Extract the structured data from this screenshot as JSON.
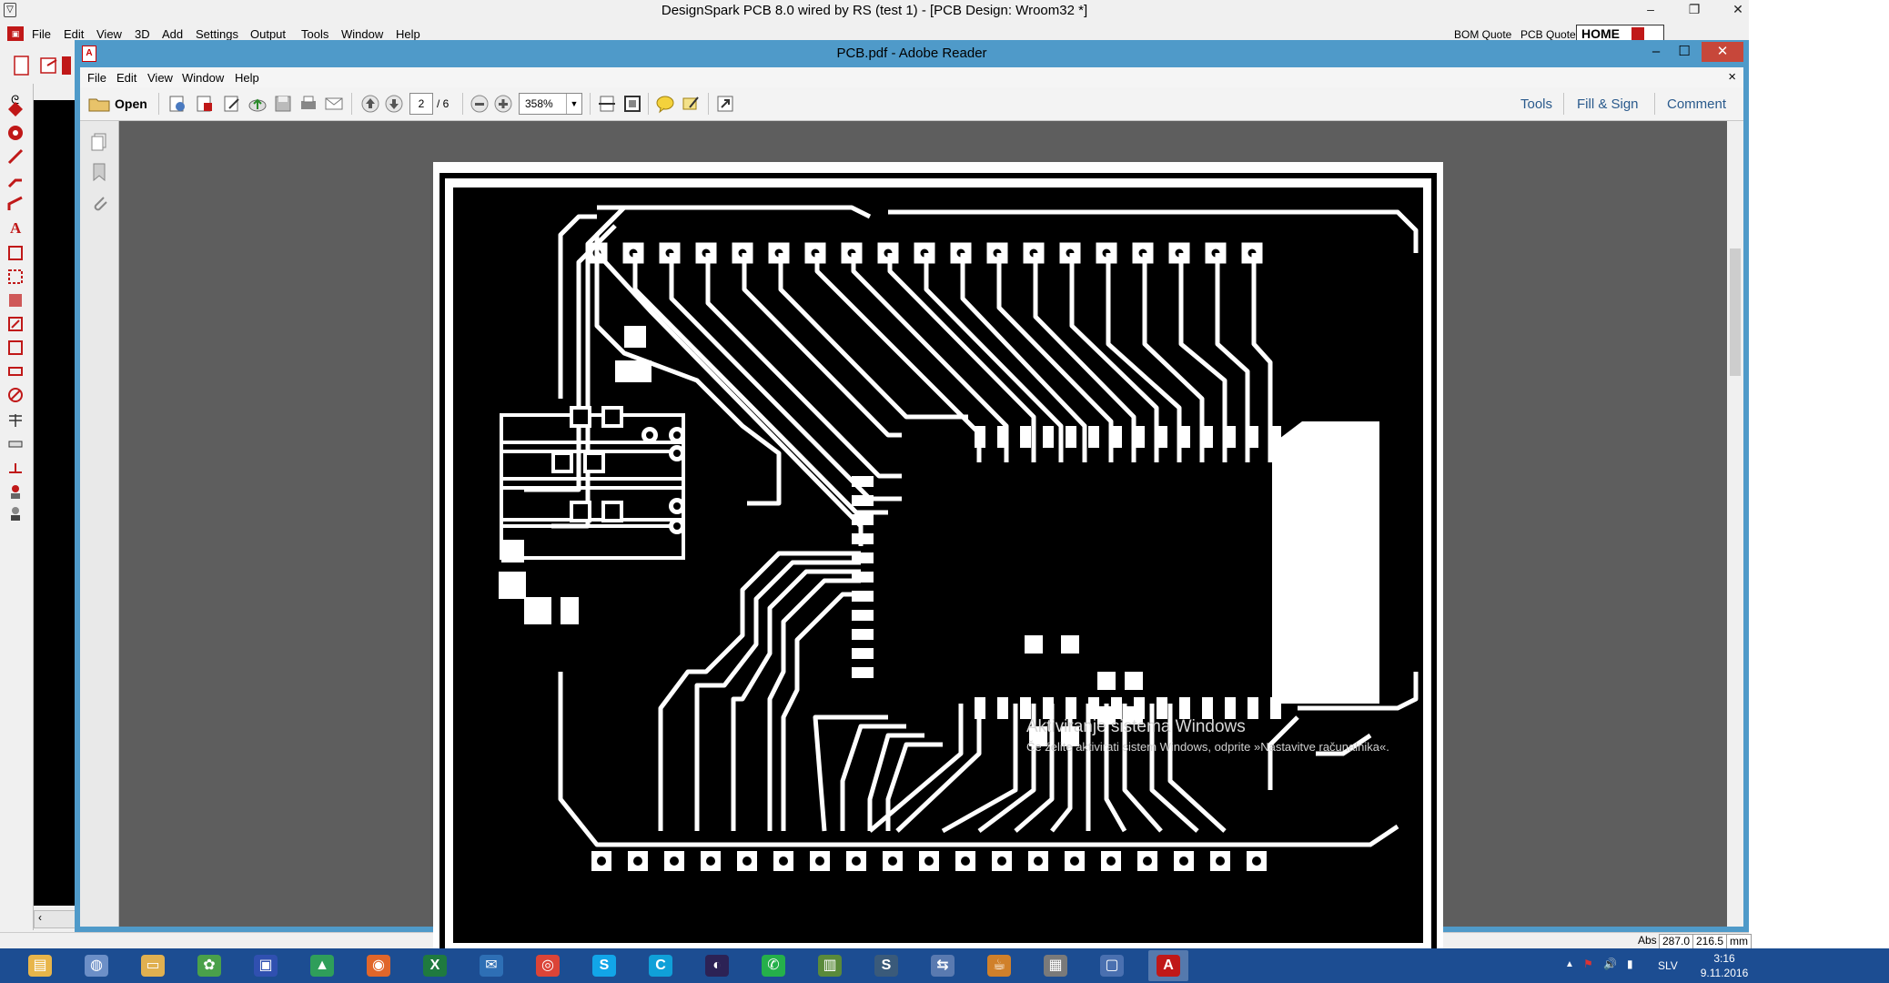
{
  "designspark": {
    "title": "DesignSpark PCB 8.0 wired by RS (test 1) - [PCB Design: Wroom32 *]",
    "menu": [
      "File",
      "Edit",
      "View",
      "3D",
      "Add",
      "Settings",
      "Output",
      "Tools",
      "Window",
      "Help"
    ],
    "right_links": [
      "BOM Quote",
      "PCB Quote"
    ],
    "home_label": "HOME",
    "status": {
      "abs_label": "Abs",
      "x": "287.0",
      "y": "216.5",
      "unit": "mm"
    }
  },
  "reader": {
    "title": "PCB.pdf - Adobe Reader",
    "menu": [
      "File",
      "Edit",
      "View",
      "Window",
      "Help"
    ],
    "open_label": "Open",
    "page_current": "2",
    "page_total": "/ 6",
    "zoom": "358%",
    "right_links": [
      "Tools",
      "Fill & Sign",
      "Comment"
    ]
  },
  "activation": {
    "title": "Aktiviranje sistema Windows",
    "subtitle": "Če želite aktivirati sistem Windows, odprite »Nastavitve računalnika«."
  },
  "taskbar": {
    "language": "SLV",
    "time": "3:16",
    "date": "9.11.2016",
    "apps": [
      {
        "name": "file-explorer-icon",
        "color": "#e8b54a",
        "glyph": "▤"
      },
      {
        "name": "network-icon",
        "color": "#6c8fc7",
        "glyph": "◍"
      },
      {
        "name": "folder-icon",
        "color": "#e0b050",
        "glyph": "▭"
      },
      {
        "name": "photos-icon",
        "color": "#4aa04a",
        "glyph": "✿"
      },
      {
        "name": "save-disk-icon",
        "color": "#3050b0",
        "glyph": "▣"
      },
      {
        "name": "google-drive-icon",
        "color": "#2f9e5a",
        "glyph": "▲"
      },
      {
        "name": "firefox-icon",
        "color": "#e0662a",
        "glyph": "◉"
      },
      {
        "name": "excel-icon",
        "color": "#1f7a3f",
        "glyph": "X"
      },
      {
        "name": "thunderbird-icon",
        "color": "#2e6fb5",
        "glyph": "✉"
      },
      {
        "name": "chrome-icon",
        "color": "#db4437",
        "glyph": "◎"
      },
      {
        "name": "skype-icon",
        "color": "#12a5e8",
        "glyph": "S"
      },
      {
        "name": "c-app-icon",
        "color": "#10a0d8",
        "glyph": "C"
      },
      {
        "name": "eclipse-icon",
        "color": "#2c2255",
        "glyph": "◐"
      },
      {
        "name": "whatsapp-icon",
        "color": "#25b04a",
        "glyph": "✆"
      },
      {
        "name": "task-manager-icon",
        "color": "#5a8a3a",
        "glyph": "▥"
      },
      {
        "name": "s-app-icon",
        "color": "#3a5a7a",
        "glyph": "S"
      },
      {
        "name": "network-share-icon",
        "color": "#5a7ab0",
        "glyph": "⇆"
      },
      {
        "name": "java-icon",
        "color": "#d0802a",
        "glyph": "☕"
      },
      {
        "name": "designspark-icon",
        "color": "#7a7a7a",
        "glyph": "▦"
      },
      {
        "name": "remote-desktop-icon",
        "color": "#4a70b0",
        "glyph": "▢"
      },
      {
        "name": "adobe-reader-icon",
        "color": "#c01818",
        "glyph": "A"
      }
    ]
  }
}
